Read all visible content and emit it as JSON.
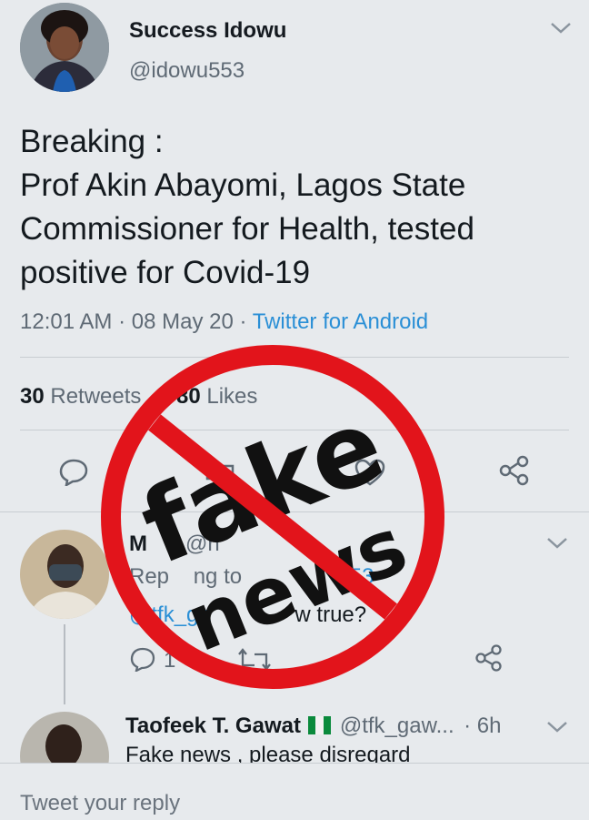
{
  "main_tweet": {
    "author_name": "Success Idowu",
    "handle": "@idowu553",
    "text_lines": [
      "Breaking :",
      "Prof Akin Abayomi, Lagos State",
      "Commissioner for Health,  tested",
      "positive for Covid-19"
    ],
    "time": "12:01 AM",
    "date": "08 May 20",
    "separator": "·",
    "source": "Twitter for Android",
    "retweets_count": "30",
    "retweets_label": "Retweets",
    "likes_count": "80",
    "likes_label": "Likes"
  },
  "reply1": {
    "name_partial": "M",
    "handle_partial": "@ri",
    "replying_partial": "Rep",
    "replying_mid": "ng to",
    "replying_end": "53",
    "mention_partial": "@tfk_ga",
    "text_partial": "w true?",
    "reply_count": "1"
  },
  "reply2": {
    "name": "Taofeek T. Gawat",
    "handle": "@tfk_gaw...",
    "time": "· 6h",
    "text": "Fake news , please disregard"
  },
  "stamp": {
    "line1": "fake",
    "line2": "news"
  },
  "compose": {
    "placeholder": "Tweet your reply"
  },
  "colors": {
    "background": "#e7eaed",
    "link": "#2a8fd6",
    "stamp_red": "#e2141b"
  },
  "icons": [
    "chevron-down-icon",
    "reply-icon",
    "retweet-icon",
    "like-icon",
    "share-icon",
    "nigeria-flag-icon"
  ]
}
